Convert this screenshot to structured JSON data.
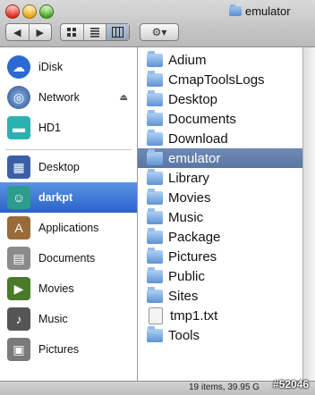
{
  "window": {
    "title": "emulator"
  },
  "toolbar": {
    "back_label": "◀",
    "forward_label": "▶",
    "action_label": "⚙▾"
  },
  "sidebar": {
    "devices": [
      {
        "label": "iDisk",
        "icon": "idisk-icon",
        "color": "#2b6ad1"
      },
      {
        "label": "Network",
        "icon": "network-globe-icon",
        "color": "#3f6fb0"
      },
      {
        "label": "HD1",
        "icon": "hard-disk-icon",
        "color": "#2bb2b0"
      }
    ],
    "places": [
      {
        "label": "Desktop",
        "icon": "desktop-folder-icon",
        "color": "#3a5fa7"
      },
      {
        "label": "darkpt",
        "icon": "user-home-icon",
        "color": "#2e9c8d",
        "selected": true
      },
      {
        "label": "Applications",
        "icon": "applications-icon",
        "color": "#9a6b3a"
      },
      {
        "label": "Documents",
        "icon": "documents-icon",
        "color": "#8b8b8b"
      },
      {
        "label": "Movies",
        "icon": "movies-clapper-icon",
        "color": "#4a7a2a"
      },
      {
        "label": "Music",
        "icon": "music-clef-icon",
        "color": "#555555"
      },
      {
        "label": "Pictures",
        "icon": "pictures-icon",
        "color": "#7a7a7a"
      }
    ]
  },
  "files": [
    {
      "name": "Adium",
      "type": "folder"
    },
    {
      "name": "CmapToolsLogs",
      "type": "folder"
    },
    {
      "name": "Desktop",
      "type": "folder"
    },
    {
      "name": "Documents",
      "type": "folder"
    },
    {
      "name": "Download",
      "type": "folder"
    },
    {
      "name": "emulator",
      "type": "folder",
      "selected": true
    },
    {
      "name": "Library",
      "type": "folder"
    },
    {
      "name": "Movies",
      "type": "folder"
    },
    {
      "name": "Music",
      "type": "folder"
    },
    {
      "name": "Package",
      "type": "folder"
    },
    {
      "name": "Pictures",
      "type": "folder"
    },
    {
      "name": "Public",
      "type": "folder"
    },
    {
      "name": "Sites",
      "type": "folder"
    },
    {
      "name": "tmp1.txt",
      "type": "document"
    },
    {
      "name": "Tools",
      "type": "folder"
    }
  ],
  "status": {
    "text": "19 items, 39.95 G"
  },
  "watermark": "#52046"
}
